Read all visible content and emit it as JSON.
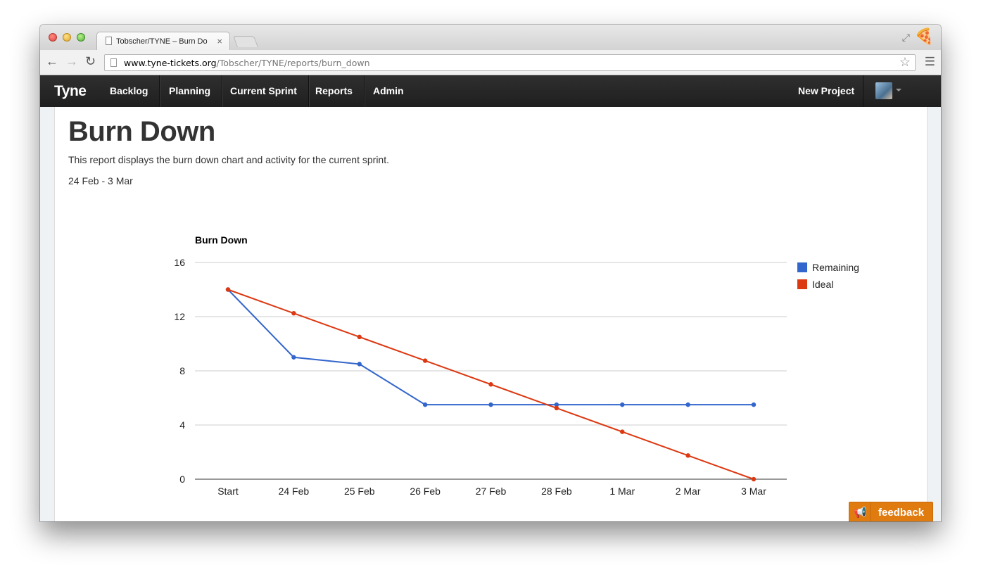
{
  "browser": {
    "tab_title": "Tobscher/TYNE – Burn Do",
    "tab_close": "×",
    "url_host": "www.tyne-tickets.org",
    "url_path": "/Tobscher/TYNE/reports/burn_down"
  },
  "navbar": {
    "brand": "Tyne",
    "items": [
      "Backlog",
      "Planning",
      "Current Sprint",
      "Reports",
      "Admin"
    ],
    "new_project": "New Project"
  },
  "page": {
    "title": "Burn Down",
    "description": "This report displays the burn down chart and activity for the current sprint.",
    "date_range": "24 Feb - 3 Mar"
  },
  "feedback": {
    "label": "feedback"
  },
  "chart_data": {
    "type": "line",
    "title": "Burn Down",
    "categories": [
      "Start",
      "24 Feb",
      "25 Feb",
      "26 Feb",
      "27 Feb",
      "28 Feb",
      "1 Mar",
      "2 Mar",
      "3 Mar"
    ],
    "ylim": [
      0,
      16
    ],
    "yticks": [
      0,
      4,
      8,
      12,
      16
    ],
    "grid": true,
    "legend": "right",
    "series": [
      {
        "name": "Remaining",
        "color": "#3366cc",
        "values": [
          14,
          9,
          8.5,
          5.5,
          5.5,
          5.5,
          5.5,
          5.5,
          5.5
        ]
      },
      {
        "name": "Ideal",
        "color": "#dc3912",
        "values": [
          14,
          12.25,
          10.5,
          8.75,
          7,
          5.25,
          3.5,
          1.75,
          0
        ]
      }
    ]
  }
}
